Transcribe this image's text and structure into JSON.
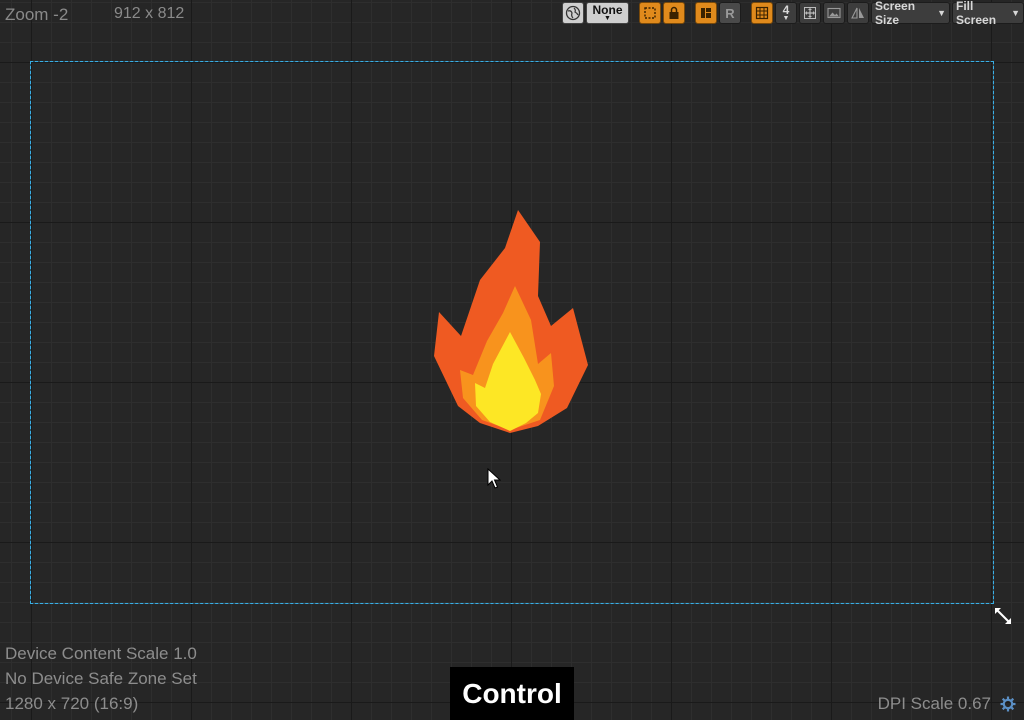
{
  "viewport": {
    "zoom_label": "Zoom -2",
    "size_label": "912 x 812"
  },
  "toolbar": {
    "world_icon": "globe-icon",
    "none_label": "None",
    "r_label": "R",
    "grid_size_value": "4",
    "screen_size_label": "Screen Size",
    "fill_screen_label": "Fill Screen"
  },
  "footer": {
    "device_content_scale": "Device Content Scale 1.0",
    "safe_zone": "No Device Safe Zone Set",
    "resolution": "1280 x 720 (16:9)",
    "dpi_scale": "DPI Scale 0.67"
  },
  "key_overlay": {
    "label": "Control"
  },
  "colors": {
    "frame": "#3ab0e6",
    "toolbar_active": "#e08a1c",
    "fire_outer": "#ef5a22",
    "fire_mid": "#f8931d",
    "fire_inner": "#fde725"
  }
}
